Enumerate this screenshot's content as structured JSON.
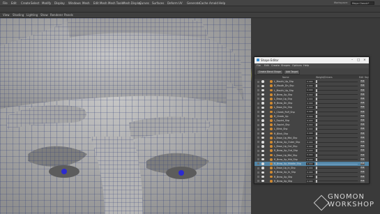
{
  "app": {
    "menu": [
      "File",
      "Edit",
      "Create",
      "Select",
      "Modify",
      "Display",
      "Windows",
      "Mesh",
      "Edit Mesh",
      "Mesh Tools",
      "Mesh Display",
      "Curves",
      "Surfaces",
      "Deform",
      "UV",
      "Generate",
      "Cache",
      "Arnold",
      "Help"
    ],
    "workspace_label": "Workspace:",
    "workspace_value": "Maya Classic*",
    "view_menu": [
      "View",
      "Shading",
      "Lighting",
      "Show",
      "Renderer",
      "Panels"
    ]
  },
  "shape_editor": {
    "title": "Shape Editor",
    "menu": [
      "File",
      "Edit",
      "Create",
      "Shapes",
      "Options",
      "Help"
    ],
    "create_button": "Create Blend Shape",
    "add_target_button": "Add Target",
    "headers": {
      "name": "Name",
      "weight": "Weight/Drivers",
      "edit": "Edit",
      "key": "Key"
    },
    "rows": [
      {
        "name": "L_Mouth_Up_Shp",
        "value": "0.000",
        "edit": "Edit"
      },
      {
        "name": "R_Mouth_Dn_Shp",
        "value": "0.000",
        "edit": "Edit"
      },
      {
        "name": "L_Mouth_Up_Shp",
        "value": "0.000",
        "edit": "Edit"
      },
      {
        "name": "R_Brow_Up_Shp",
        "value": "0.000",
        "edit": "Edit"
      },
      {
        "name": "L_Brow_Up_Shp",
        "value": "0.000",
        "edit": "Edit"
      },
      {
        "name": "R_Brow_Dn_Shp",
        "value": "0.000",
        "edit": "Edit"
      },
      {
        "name": "L_Brow_Dn_Shp",
        "value": "0.000",
        "edit": "Edit"
      },
      {
        "name": "L_Cheek_Puff_Shp",
        "value": "0.000",
        "edit": "Edit"
      },
      {
        "name": "R_Cheek_Up",
        "value": "0.000",
        "edit": "Edit"
      },
      {
        "name": "L_Squint_Shp",
        "value": "0.000",
        "edit": "Edit"
      },
      {
        "name": "R_Squint_Shp",
        "value": "0.000",
        "edit": "Edit"
      },
      {
        "name": "L_Blink_Shp",
        "value": "0.000",
        "edit": "Edit"
      },
      {
        "name": "R_Blink_Shp",
        "value": "0.000",
        "edit": "Edit"
      },
      {
        "name": "L_Brow_Up_Mid_Shp",
        "value": "0.000",
        "edit": "Edit"
      },
      {
        "name": "R_Brow_Up_Outer_Shp",
        "value": "0.000",
        "edit": "Edit"
      },
      {
        "name": "L_Brow_Up_Out_Shp",
        "value": "0.000",
        "edit": "Edit"
      },
      {
        "name": "R_Brow_Up_Out_Shp",
        "value": "0.000",
        "edit": "Edit"
      },
      {
        "name": "L_Brow_Up_Mid_Shp",
        "value": "0.000",
        "edit": "Edit"
      },
      {
        "name": "R_Brow_Up_Mid_Shp",
        "value": "0.000",
        "edit": "Edit"
      },
      {
        "name": "R_Brow_Up_Middle_Shp",
        "value": "0.000",
        "edit": "Edit",
        "selected": true
      },
      {
        "name": "L_Brow_Up_In_Shp",
        "value": "0.000",
        "edit": "Edit"
      },
      {
        "name": "R_Brow_Up_In_Shp",
        "value": "0.000",
        "edit": "Edit"
      },
      {
        "name": "R_Brow_Up_Shp",
        "value": "0.000",
        "edit": "Edit"
      },
      {
        "name": "R_Brow_Up_Shp",
        "value": "0.000",
        "edit": "Edit"
      }
    ]
  },
  "watermark": {
    "line1": "GNOMON",
    "line2": "WORKSHOP"
  }
}
